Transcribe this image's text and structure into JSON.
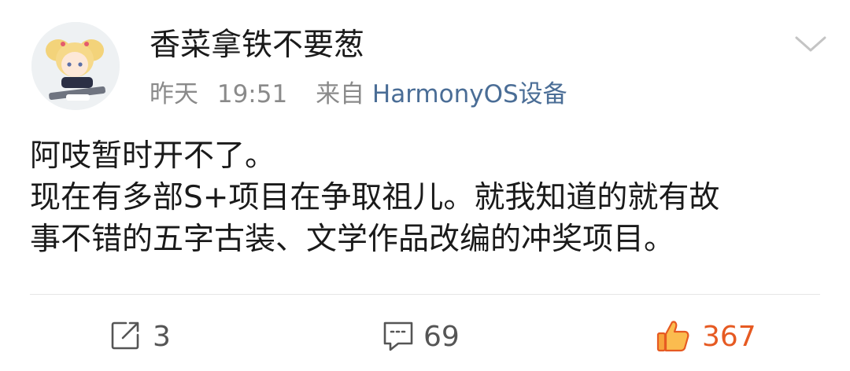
{
  "post": {
    "username": "香菜拿铁不要葱",
    "date": "昨天",
    "time": "19:51",
    "source_prefix": "来自",
    "source": "HarmonyOS设备",
    "content_lines": [
      "阿吱暂时开不了。",
      "现在有多部S+项目在争取祖儿。就我知道的就有故",
      "事不错的五字古装、文学作品改编的冲奖项目。"
    ]
  },
  "actions": {
    "repost_count": "3",
    "comment_count": "69",
    "like_count": "367"
  },
  "icons": {
    "more": "chevron-down-icon",
    "repost": "share-icon",
    "comment": "comment-icon",
    "like": "thumbs-up-icon"
  },
  "colors": {
    "source_link": "#4a6d96",
    "like_accent": "#e65a22",
    "meta_gray": "#8a8a8a"
  }
}
